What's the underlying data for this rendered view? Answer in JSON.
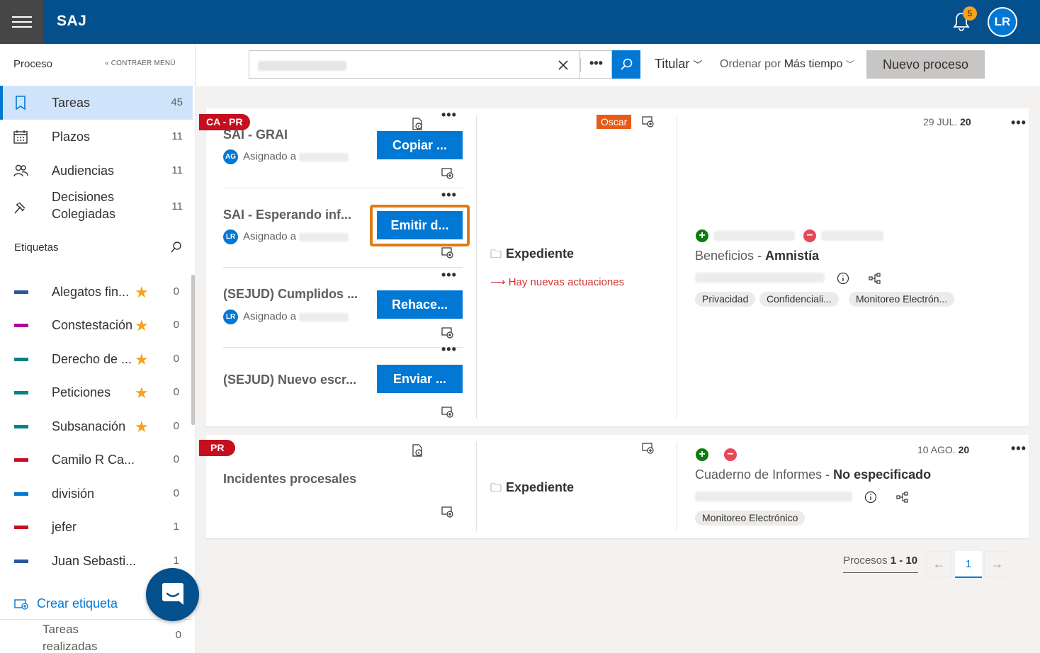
{
  "app": {
    "brand": "SAJ",
    "notifications": "5",
    "user_initials": "LR"
  },
  "sidebar": {
    "heading": "Proceso",
    "collapse_label": "CONTRAER MENÚ",
    "nav": [
      {
        "label": "Tareas",
        "count": "45",
        "icon": "book-icon",
        "selected": true
      },
      {
        "label": "Plazos",
        "count": "11",
        "icon": "calendar-icon"
      },
      {
        "label": "Audiencias",
        "count": "11",
        "icon": "people-icon"
      },
      {
        "label": "Decisiones Colegiadas",
        "count": "11",
        "icon": "gavel-icon"
      }
    ],
    "tags_title": "Etiquetas",
    "tags": [
      {
        "label": "Alegatos fin...",
        "count": "0",
        "color": "#2b579a",
        "star": true
      },
      {
        "label": "Constestación",
        "count": "0",
        "color": "#b4009e",
        "star": true
      },
      {
        "label": "Derecho de ...",
        "count": "0",
        "color": "#038387",
        "star": true
      },
      {
        "label": "Peticiones",
        "count": "0",
        "color": "#038387",
        "star": true
      },
      {
        "label": "Subsanación",
        "count": "0",
        "color": "#038387",
        "star": true
      },
      {
        "label": "Camilo R Ca...",
        "count": "0",
        "color": "#c50f1f",
        "star": false
      },
      {
        "label": "división",
        "count": "0",
        "color": "#0078d4",
        "star": false
      },
      {
        "label": "jefer",
        "count": "1",
        "color": "#c50f1f",
        "star": false
      },
      {
        "label": "Juan Sebasti...",
        "count": "1",
        "color": "#2b579a",
        "star": false
      }
    ],
    "create_tag": "Crear etiqueta",
    "done_label": "Tareas realizadas",
    "done_count": "0"
  },
  "toolbar": {
    "search_value": "",
    "titular": "Titular",
    "order_prefix": "Ordenar por",
    "order_value": "Más tiempo",
    "new_process": "Nuevo proceso"
  },
  "cards": [
    {
      "ribbon": "CA - PR",
      "tasks": [
        {
          "title": "SAI - GRAI",
          "assignee_initials": "AG",
          "assign_label": "Asignado a",
          "action": "Copiar ..."
        },
        {
          "title": "SAI - Esperando inf...",
          "assignee_initials": "LR",
          "assign_label": "Asignado a",
          "action": "Emitir d..."
        },
        {
          "title": "(SEJUD) Cumplidos ...",
          "assignee_initials": "LR",
          "assign_label": "Asignado a",
          "action": "Rehace..."
        },
        {
          "title": "(SEJUD) Nuevo escr...",
          "action": "Enviar ..."
        }
      ],
      "badge": "Oscar",
      "expediente": "Expediente",
      "nuevas": "Hay nuevas actuaciones",
      "date_prefix": "29 JUL.",
      "date_year": "20",
      "process_name": "Beneficios",
      "process_sep": " - ",
      "process_detail": "Amnistía",
      "chips": [
        "Privacidad",
        "Confidenciali...",
        "Monitoreo Electrón..."
      ]
    },
    {
      "ribbon": "PR",
      "task_title": "Incidentes procesales",
      "expediente": "Expediente",
      "date_prefix": "10 AGO.",
      "date_year": "20",
      "process_name": "Cuaderno de Informes",
      "process_sep": " - ",
      "process_detail": "No especificado",
      "chips": [
        "Monitoreo Electrónico"
      ]
    }
  ],
  "pager": {
    "label": "Procesos",
    "range": "1 - 10",
    "current": "1"
  },
  "colors": {
    "topbar": "#03508d",
    "accent": "#0078d4",
    "ribbon": "#c50f1f",
    "highlight": "#e07c12"
  }
}
